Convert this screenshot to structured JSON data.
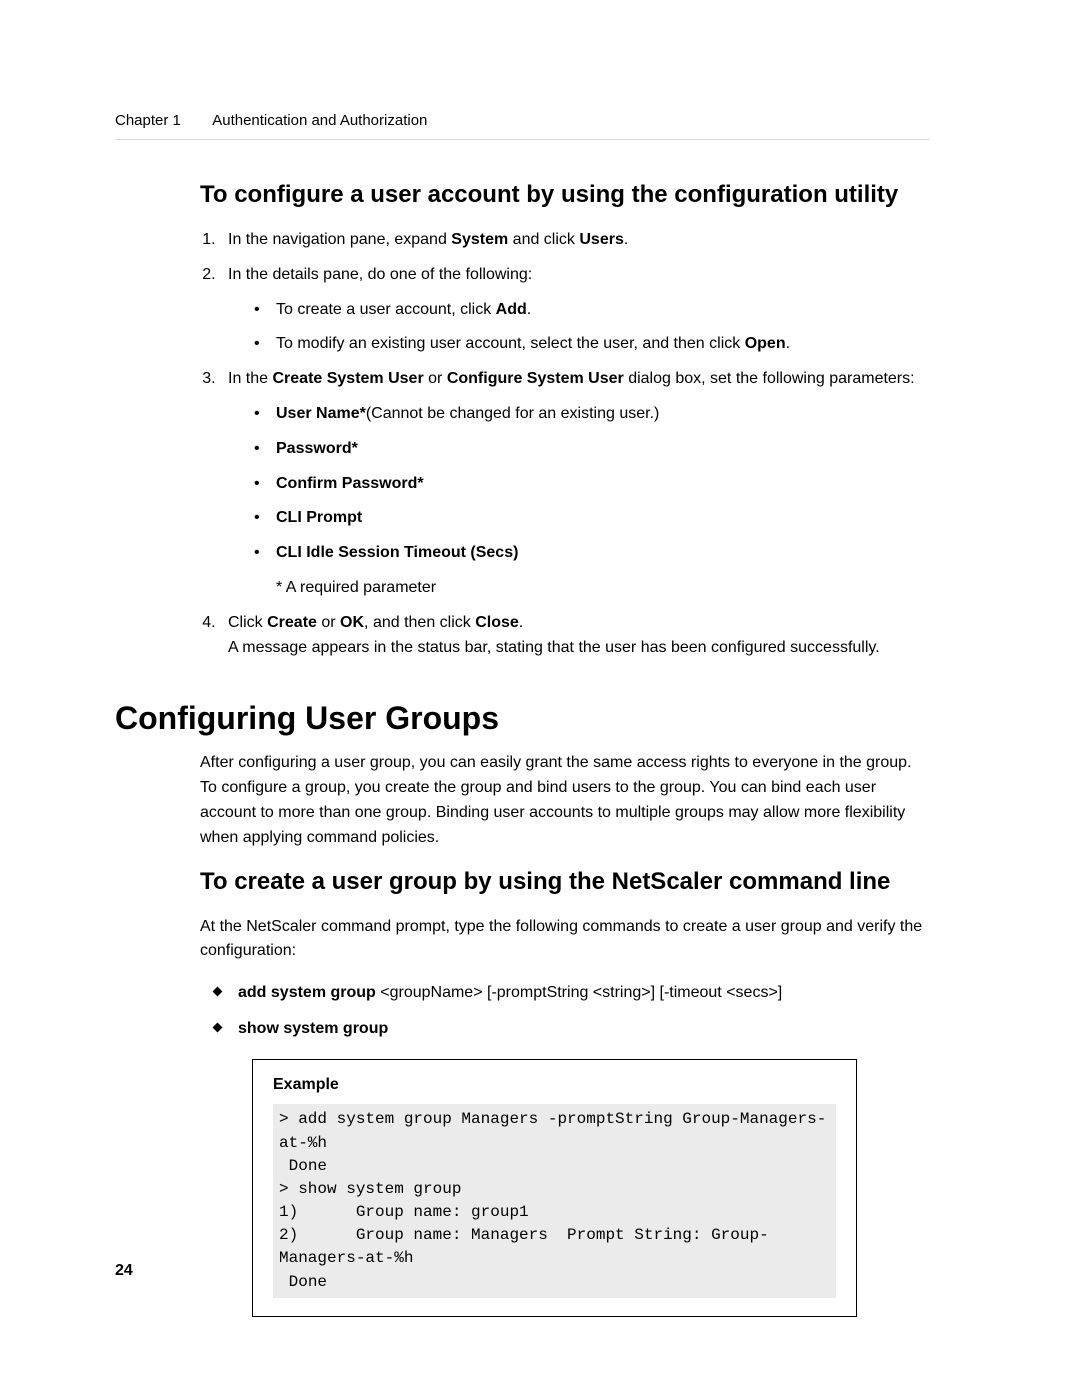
{
  "header": {
    "chapter_label": "Chapter 1",
    "chapter_title": "Authentication and Authorization"
  },
  "section1": {
    "heading": "To configure a user account by using the configuration utility",
    "steps": {
      "s1": {
        "pre": "In the navigation pane, expand ",
        "b1": "System",
        "mid": " and click ",
        "b2": "Users",
        "post": "."
      },
      "s2": {
        "text": "In the details pane, do one of the following:",
        "bullets": {
          "b1": {
            "pre": "To create a user account, click ",
            "bold": "Add",
            "post": "."
          },
          "b2": {
            "pre": "To modify an existing user account, select the user, and then click ",
            "bold": "Open",
            "post": "."
          }
        }
      },
      "s3": {
        "pre": "In the ",
        "b1": "Create System User",
        "mid1": " or ",
        "b2": "Configure System User",
        "post": " dialog box, set the following parameters:",
        "params": {
          "p1": {
            "bold": "User Name*",
            "note": "(Cannot be changed for an existing user.)"
          },
          "p2": {
            "bold": "Password*"
          },
          "p3": {
            "bold": "Confirm Password*"
          },
          "p4": {
            "bold": "CLI Prompt"
          },
          "p5": {
            "bold": "CLI Idle Session Timeout (Secs)"
          }
        },
        "required_note": "* A required parameter"
      },
      "s4": {
        "pre": "Click ",
        "b1": "Create",
        "mid1": " or ",
        "b2": "OK",
        "mid2": ", and then click ",
        "b3": "Close",
        "post": ".",
        "line2": "A message appears in the status bar, stating that the user has been configured successfully."
      }
    }
  },
  "section2": {
    "main_heading": "Configuring User Groups",
    "intro": "After configuring a user group, you can easily grant the same access rights to everyone in the group. To configure a group, you create the group and bind users to the group. You can bind each user account to more than one group. Binding user accounts to multiple groups may allow more flexibility when applying command policies.",
    "sub_heading": "To create a user group by using the NetScaler command line",
    "lead": "At the NetScaler command prompt, type the following commands to create a user group and verify the configuration:",
    "cmds": {
      "c1": {
        "bold": "add system group",
        "rest": " <groupName> [-promptString <string>] [-timeout <secs>]"
      },
      "c2": {
        "bold": "show system group"
      }
    },
    "example": {
      "title": "Example",
      "code": "> add system group Managers -promptString Group-Managers-at-%h\n Done\n> show system group\n1)      Group name: group1\n2)      Group name: Managers  Prompt String: Group-Managers-at-%h\n Done"
    }
  },
  "page_number": "24"
}
